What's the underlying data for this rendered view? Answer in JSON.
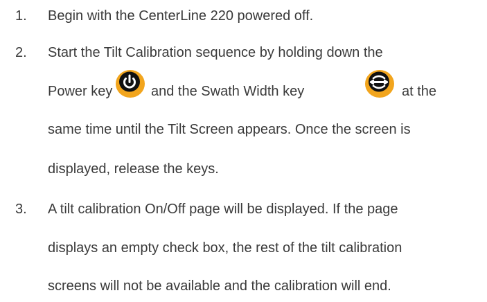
{
  "steps": [
    {
      "number": "1.",
      "lines": [
        "Begin with the CenterLine 220 powered off."
      ]
    },
    {
      "number": "2.",
      "lines": [
        "Start the Tilt Calibration sequence by holding down the",
        "Power key",
        "and the Swath Width key",
        "at the",
        "same time until the Tilt Screen appears. Once the screen is",
        "displayed, release the keys."
      ],
      "icons": [
        "power-key-icon",
        "swath-width-key-icon"
      ]
    },
    {
      "number": "3.",
      "lines": [
        "A tilt calibration On/Off page will be displayed. If the page",
        "displays an empty check box, the rest of the tilt calibration",
        "screens will not be available and the calibration will end."
      ]
    }
  ],
  "colors": {
    "text": "#3a3a3a",
    "key_ring": "#f2a51d",
    "key_fill": "#111111",
    "key_symbol": "#ffffff"
  }
}
